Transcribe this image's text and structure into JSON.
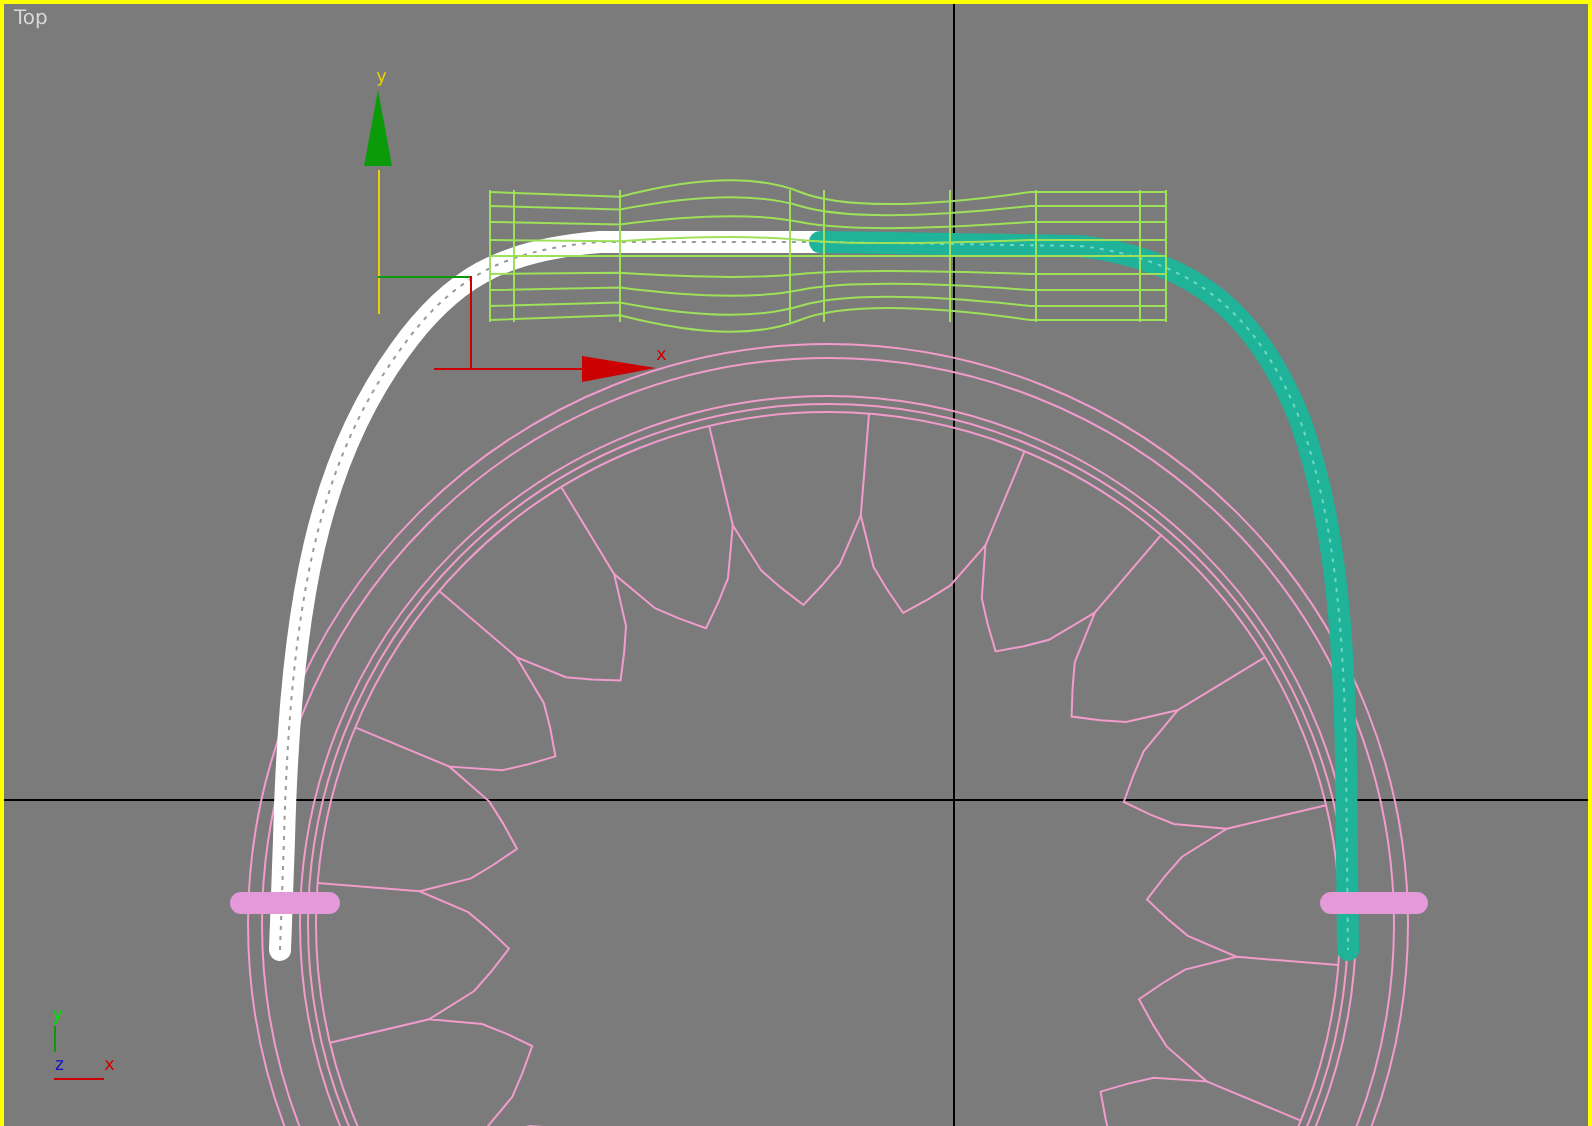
{
  "viewport": {
    "label": "Top",
    "active": true
  },
  "transform_gizmo": {
    "x_label": "x",
    "y_label": "y"
  },
  "axis_tripod": {
    "x_label": "x",
    "y_label": "y",
    "z_label": "z"
  }
}
